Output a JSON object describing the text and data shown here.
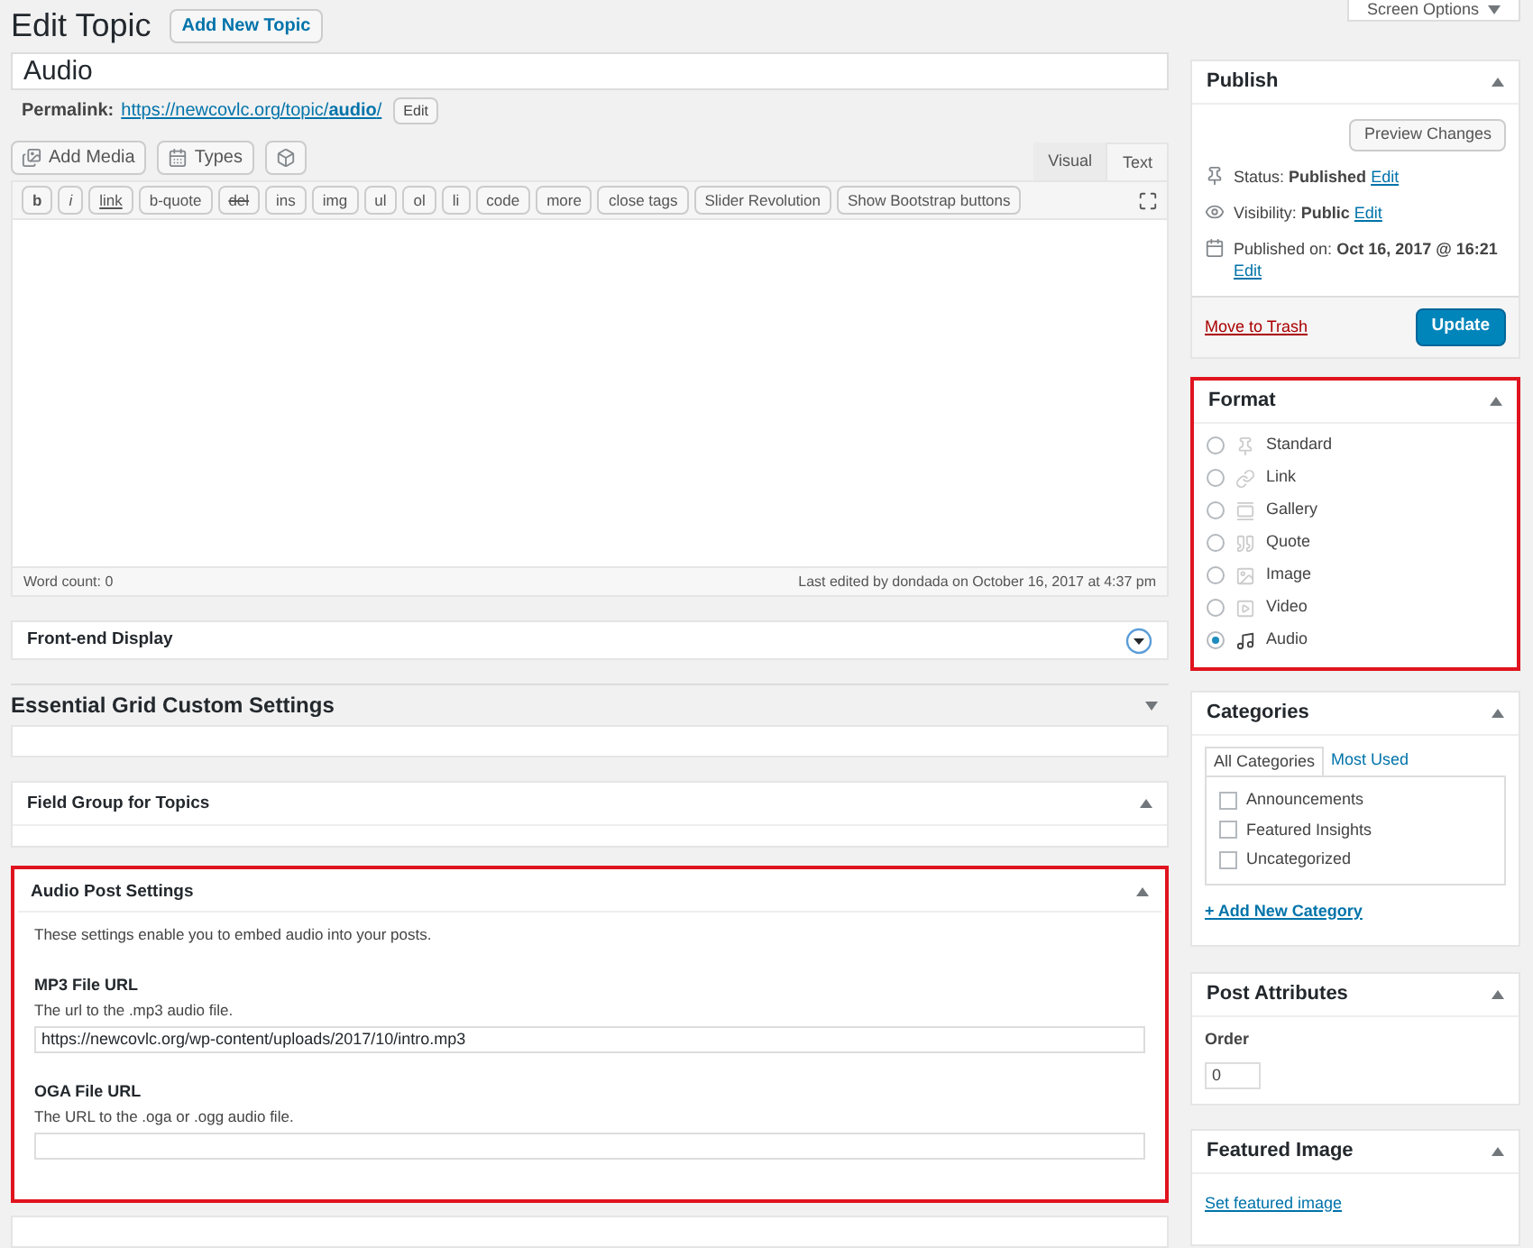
{
  "header": {
    "title": "Edit Topic",
    "add_new_button": "Add New Topic",
    "screen_options": "Screen Options"
  },
  "title_field": {
    "value": "Audio"
  },
  "permalink": {
    "label": "Permalink:",
    "url": "https://newcovlc.org/topic/**audio**/",
    "edit_button": "Edit"
  },
  "editor": {
    "media_buttons": [
      {
        "kind": "media",
        "label": "Add Media"
      },
      {
        "kind": "types",
        "label": "Types"
      },
      {
        "kind": "block"
      }
    ],
    "tabs": [
      {
        "label": "Visual",
        "selected": false
      },
      {
        "label": "Text",
        "selected": true
      }
    ],
    "quicktags": [
      {
        "label": "b",
        "kind": "bold"
      },
      {
        "label": "i",
        "kind": "italic"
      },
      {
        "label": "link",
        "kind": "underline"
      },
      {
        "label": "b-quote",
        "kind": "plain"
      },
      {
        "label": "del",
        "kind": "strike"
      },
      {
        "label": "ins",
        "kind": "plain"
      },
      {
        "label": "img",
        "kind": "plain"
      },
      {
        "label": "ul",
        "kind": "plain"
      },
      {
        "label": "ol",
        "kind": "plain"
      },
      {
        "label": "li",
        "kind": "plain"
      },
      {
        "label": "code",
        "kind": "plain"
      },
      {
        "label": "more",
        "kind": "plain"
      },
      {
        "label": "close tags",
        "kind": "plain"
      },
      {
        "label": "Slider Revolution",
        "kind": "plain"
      },
      {
        "label": "Show Bootstrap buttons",
        "kind": "plain"
      }
    ],
    "word_count": "Word count: 0",
    "last_edited": "Last edited by dondada on October 16, 2017 at 4:37 pm"
  },
  "frontend_display": {
    "title": "Front-end Display",
    "expanded": false
  },
  "essential_grid": {
    "title": "Essential Grid Custom Settings",
    "expanded": false
  },
  "field_group": {
    "title": "Field Group for Topics",
    "expanded": true
  },
  "audio_settings": {
    "title": "Audio Post Settings",
    "highlighted": true,
    "description": "These settings enable you to embed audio into your posts.",
    "fields": [
      {
        "label": "MP3 File URL",
        "hint": "The url to the .mp3 audio file.",
        "value": "https://newcovlc.org/wp-content/uploads/2017/10/intro.mp3"
      },
      {
        "label": "OGA File URL",
        "hint": "The URL to the .oga or .ogg audio file."
      }
    ]
  },
  "publish": {
    "title": "Publish",
    "preview_button": "Preview Changes",
    "rows": [
      {
        "kind": "status",
        "label": "Status:",
        "value": "Published",
        "link": "Edit"
      },
      {
        "kind": "visibility",
        "label": "Visibility:",
        "value": "Public",
        "link": "Edit"
      },
      {
        "kind": "date",
        "label": "Published on:",
        "value": "Oct 16, 2017 @ 16:21",
        "link": "Edit"
      }
    ],
    "trash_link": "Move to Trash",
    "update_button": "Update"
  },
  "format": {
    "title": "Format",
    "highlighted": true,
    "options": [
      {
        "kind": "standard",
        "label": "Standard",
        "selected": false
      },
      {
        "kind": "link",
        "label": "Link",
        "selected": false
      },
      {
        "kind": "gallery",
        "label": "Gallery",
        "selected": false
      },
      {
        "kind": "quote",
        "label": "Quote",
        "selected": false
      },
      {
        "kind": "image",
        "label": "Image",
        "selected": false
      },
      {
        "kind": "video",
        "label": "Video",
        "selected": false
      },
      {
        "kind": "audio",
        "label": "Audio",
        "selected": true
      }
    ]
  },
  "categories": {
    "title": "Categories",
    "tabs": [
      {
        "label": "All Categories",
        "selected": true
      },
      {
        "label": "Most Used",
        "selected": false
      }
    ],
    "items": [
      {
        "label": "Announcements",
        "checked": false
      },
      {
        "label": "Featured Insights",
        "checked": false
      },
      {
        "label": "Uncategorized",
        "checked": false
      }
    ],
    "add_link": "+ Add New Category"
  },
  "post_attributes": {
    "title": "Post Attributes",
    "order_label": "Order",
    "order_value": "0"
  },
  "featured_image": {
    "title": "Featured Image",
    "link": "Set featured image"
  }
}
